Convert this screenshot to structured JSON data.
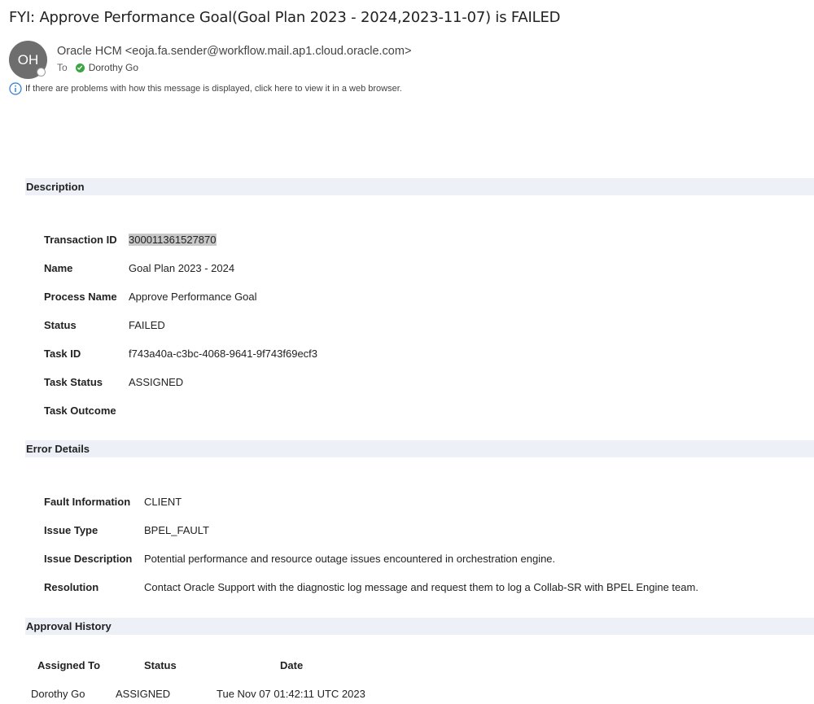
{
  "email": {
    "subject": "FYI: Approve Performance Goal(Goal Plan 2023 - 2024,2023-11-07) is FAILED",
    "avatar_initials": "OH",
    "sender": "Oracle HCM <eoja.fa.sender@workflow.mail.ap1.cloud.oracle.com>",
    "to_label": "To",
    "recipient": "Dorothy Go",
    "info_text": "If there are problems with how this message is displayed, click here to view it in a web browser."
  },
  "description": {
    "heading": "Description",
    "rows": [
      {
        "label": "Transaction ID",
        "value": "300011361527870"
      },
      {
        "label": "Name",
        "value": "Goal Plan 2023 - 2024"
      },
      {
        "label": "Process Name",
        "value": "Approve Performance Goal"
      },
      {
        "label": "Status",
        "value": "FAILED"
      },
      {
        "label": "Task ID",
        "value": "f743a40a-c3bc-4068-9641-9f743f69ecf3"
      },
      {
        "label": "Task Status",
        "value": "ASSIGNED"
      },
      {
        "label": "Task Outcome",
        "value": ""
      }
    ]
  },
  "error_details": {
    "heading": "Error Details",
    "rows": [
      {
        "label": "Fault Information",
        "value": "CLIENT"
      },
      {
        "label": "Issue Type",
        "value": "BPEL_FAULT"
      },
      {
        "label": "Issue Description",
        "value": "Potential performance and resource outage issues encountered in orchestration engine."
      },
      {
        "label": "Resolution",
        "value": "Contact Oracle Support with the diagnostic log message and request them to log a Collab-SR with BPEL Engine team."
      }
    ]
  },
  "approval_history": {
    "heading": "Approval History",
    "columns": [
      "Assigned To",
      "Status",
      "Date"
    ],
    "rows": [
      {
        "assigned_to": "Dorothy Go",
        "status": "ASSIGNED",
        "date": "Tue Nov 07 01:42:11 UTC 2023"
      }
    ]
  },
  "colors": {
    "section_bar": "#edf0f7",
    "avatar": "#6e6e6e",
    "presence_check": "#3aa541",
    "info_icon": "#2b7cd3",
    "highlight": "#c8c8c8"
  }
}
